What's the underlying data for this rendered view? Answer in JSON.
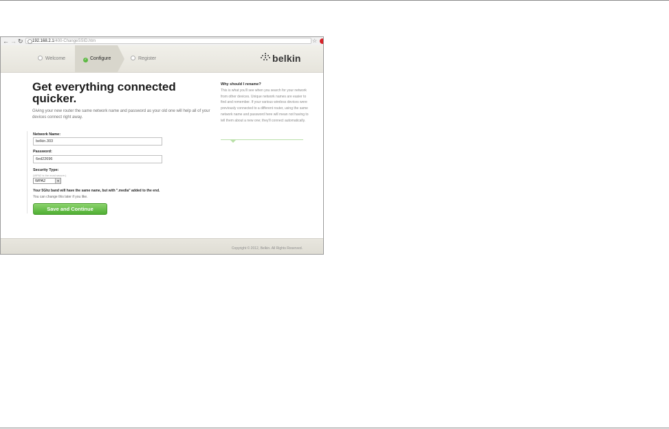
{
  "browser": {
    "url_host": "192.168.2.1",
    "url_path": "/400-ChangeSSID.htm",
    "back_icon": "arrow-left",
    "forward_icon": "arrow-right",
    "reload_icon": "reload",
    "star_icon": "star"
  },
  "steps": [
    {
      "label": "Welcome",
      "state": "inactive"
    },
    {
      "label": "Configure",
      "state": "active"
    },
    {
      "label": "Register",
      "state": "inactive"
    }
  ],
  "brand": {
    "name": "belkin",
    "accent": "#5cb843"
  },
  "main": {
    "title": "Get everything connected quicker.",
    "intro": "Giving your new router the same network name and password as your old one will help all of your devices connect right away.",
    "network_name_label": "Network Name:",
    "network_name_value": "belkin.303",
    "password_label": "Password:",
    "password_value": "6ed22696",
    "security_label": "Security Type:",
    "security_hint": "(WPA2 is the most secure.)",
    "security_value": "WPA2",
    "band_note": "Your 5Ghz band will have the same name, but with \".media\" added to the end.",
    "change_note": "You can change this later if you like.",
    "save_label": "Save and Continue"
  },
  "side": {
    "title": "Why should I rename?",
    "text": "This is what you'll see when you search for your network from other devices. Unique network names are easier to find and remember. If your various wireless devices were previously connected to a different router, using the same network name and password here will mean not having to tell them about a new one; they'll connect automatically."
  },
  "footer": {
    "copyright": "Copyright © 2012, Belkin. All Rights Reserved."
  }
}
